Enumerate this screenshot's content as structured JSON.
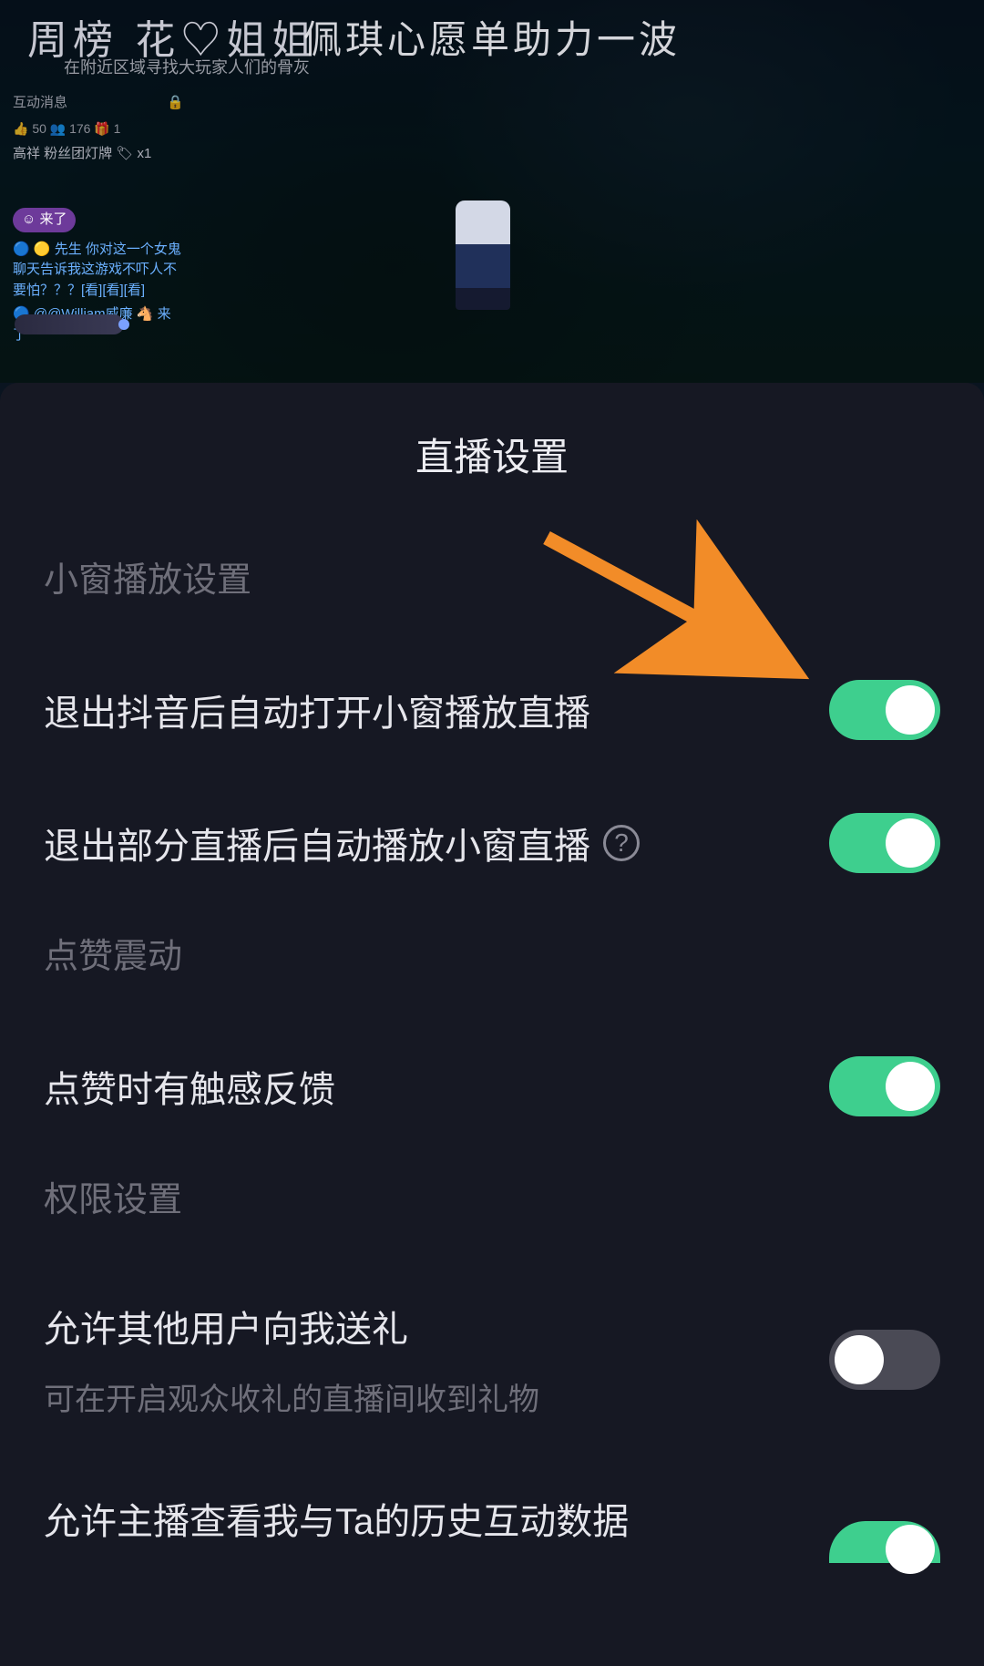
{
  "background": {
    "topLeftTitle": "周榜 花♡姐姐",
    "topSubtitle": "在附近区域寻找大玩家人们的骨灰",
    "bannerText": "佩琪心愿单助力一波",
    "chat": {
      "header": "互动消息",
      "lockIcon": "lock",
      "stats": "👍 50  👥 176  🎁 1",
      "line1": "高祥  粉丝团灯牌 🏷 x1",
      "ufoLabel": "",
      "pill": "☺ 来了",
      "line2": "🔵 🟡 先生  你对这一个女鬼聊天告诉我这游戏不吓人不要怕？？？[看][看][看]",
      "line3": "🔵 @@William威廉 🐴 来了"
    }
  },
  "sheet": {
    "title": "直播设置",
    "section1": {
      "header": "小窗播放设置",
      "item1": {
        "label": "退出抖音后自动打开小窗播放直播",
        "on": true
      },
      "item2": {
        "label": "退出部分直播后自动播放小窗直播",
        "help": "?",
        "on": true
      }
    },
    "section2": {
      "header": "点赞震动",
      "item1": {
        "label": "点赞时有触感反馈",
        "on": true
      }
    },
    "section3": {
      "header": "权限设置",
      "item1": {
        "label": "允许其他用户向我送礼",
        "sub": "可在开启观众收礼的直播间收到礼物",
        "on": false
      },
      "item2": {
        "label": "允许主播查看我与Ta的历史互动数据",
        "on": true
      }
    }
  },
  "annotation": {
    "arrowColor": "#f28c28"
  }
}
